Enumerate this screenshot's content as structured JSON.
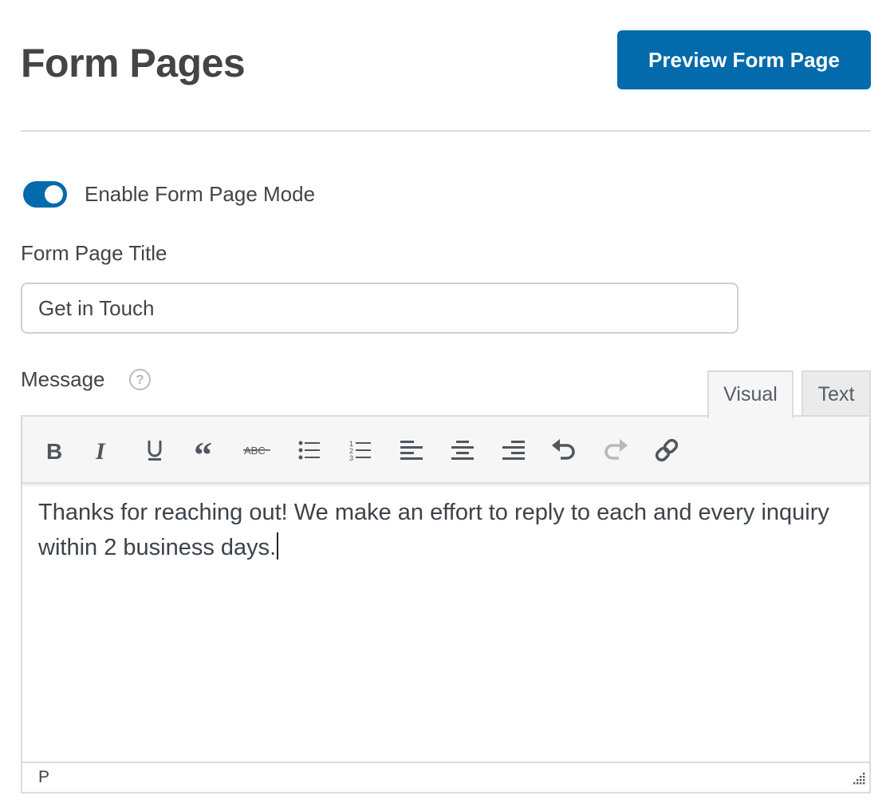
{
  "header": {
    "title": "Form Pages",
    "preview_button_label": "Preview Form Page"
  },
  "colors": {
    "accent": "#036aab",
    "text": "#444444",
    "border": "#dcdcdc",
    "toolbar_bg": "#f6f6f6",
    "disabled_icon": "#b4b9be",
    "icon": "#50575e"
  },
  "settings": {
    "enable_toggle": {
      "label": "Enable Form Page Mode",
      "checked": true
    },
    "title_field": {
      "label": "Form Page Title",
      "value": "Get in Touch"
    },
    "message_field": {
      "label": "Message",
      "help_icon": "question-circle-icon"
    }
  },
  "editor": {
    "tabs": [
      {
        "label": "Visual",
        "active": true
      },
      {
        "label": "Text",
        "active": false
      }
    ],
    "toolbar": [
      {
        "name": "bold",
        "icon": "bold-icon",
        "enabled": true
      },
      {
        "name": "italic",
        "icon": "italic-icon",
        "enabled": true
      },
      {
        "name": "underline",
        "icon": "underline-icon",
        "enabled": true
      },
      {
        "name": "blockquote",
        "icon": "quote-icon",
        "enabled": true
      },
      {
        "name": "strikethrough",
        "icon": "strikethrough-icon",
        "enabled": true
      },
      {
        "name": "bullet-list",
        "icon": "bullet-list-icon",
        "enabled": true
      },
      {
        "name": "numbered-list",
        "icon": "numbered-list-icon",
        "enabled": true
      },
      {
        "name": "align-left",
        "icon": "align-left-icon",
        "enabled": true
      },
      {
        "name": "align-center",
        "icon": "align-center-icon",
        "enabled": true
      },
      {
        "name": "align-right",
        "icon": "align-right-icon",
        "enabled": true
      },
      {
        "name": "undo",
        "icon": "undo-icon",
        "enabled": true
      },
      {
        "name": "redo",
        "icon": "redo-icon",
        "enabled": false
      },
      {
        "name": "link",
        "icon": "link-icon",
        "enabled": true
      }
    ],
    "content": "Thanks for reaching out! We make an effort to reply to each and every inquiry within 2 business days.",
    "status_path": "P"
  }
}
